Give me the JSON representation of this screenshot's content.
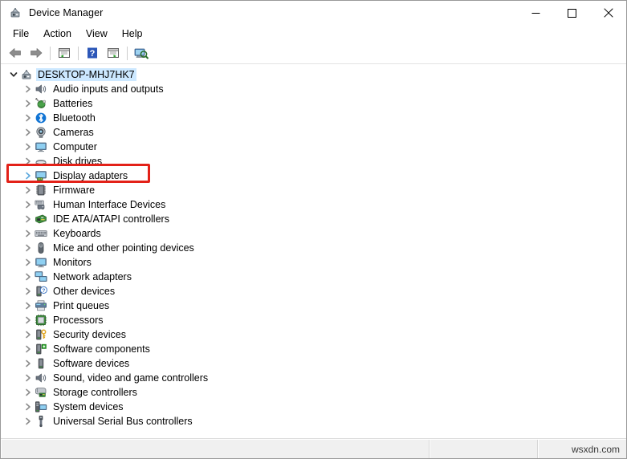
{
  "window": {
    "title": "Device Manager",
    "app_icon": "device-manager-icon",
    "controls": {
      "minimize": "minimize-button",
      "maximize": "maximize-button",
      "close": "close-button"
    }
  },
  "menubar": {
    "items": [
      {
        "label": "File"
      },
      {
        "label": "Action"
      },
      {
        "label": "View"
      },
      {
        "label": "Help"
      }
    ]
  },
  "toolbar": {
    "buttons": [
      {
        "name": "back-button",
        "icon": "back-arrow-icon"
      },
      {
        "name": "forward-button",
        "icon": "forward-arrow-icon"
      },
      {
        "name": "separator-1",
        "icon": "separator"
      },
      {
        "name": "show-hide-console-tree-button",
        "icon": "console-tree-icon"
      },
      {
        "name": "separator-2",
        "icon": "separator"
      },
      {
        "name": "help-button",
        "icon": "help-question-icon"
      },
      {
        "name": "properties-button",
        "icon": "properties-icon"
      },
      {
        "name": "separator-3",
        "icon": "separator"
      },
      {
        "name": "scan-for-hardware-changes-button",
        "icon": "scan-hardware-icon"
      }
    ]
  },
  "tree": {
    "root": {
      "label": "DESKTOP-MHJ7HK7",
      "icon": "computer-root-icon",
      "expanded": true,
      "selected": true
    },
    "items": [
      {
        "label": "Audio inputs and outputs",
        "icon": "speaker-icon"
      },
      {
        "label": "Batteries",
        "icon": "battery-icon"
      },
      {
        "label": "Bluetooth",
        "icon": "bluetooth-icon"
      },
      {
        "label": "Cameras",
        "icon": "camera-icon"
      },
      {
        "label": "Computer",
        "icon": "monitor-icon"
      },
      {
        "label": "Disk drives",
        "icon": "disk-drive-icon"
      },
      {
        "label": "Display adapters",
        "icon": "display-adapter-icon",
        "highlighted": true
      },
      {
        "label": "Firmware",
        "icon": "firmware-chip-icon"
      },
      {
        "label": "Human Interface Devices",
        "icon": "hid-icon"
      },
      {
        "label": "IDE ATA/ATAPI controllers",
        "icon": "ide-controller-icon"
      },
      {
        "label": "Keyboards",
        "icon": "keyboard-icon"
      },
      {
        "label": "Mice and other pointing devices",
        "icon": "mouse-icon"
      },
      {
        "label": "Monitors",
        "icon": "monitor-icon"
      },
      {
        "label": "Network adapters",
        "icon": "network-adapter-icon"
      },
      {
        "label": "Other devices",
        "icon": "unknown-device-icon"
      },
      {
        "label": "Print queues",
        "icon": "printer-icon"
      },
      {
        "label": "Processors",
        "icon": "processor-icon"
      },
      {
        "label": "Security devices",
        "icon": "security-device-icon"
      },
      {
        "label": "Software components",
        "icon": "software-component-icon"
      },
      {
        "label": "Software devices",
        "icon": "software-device-icon"
      },
      {
        "label": "Sound, video and game controllers",
        "icon": "speaker-icon"
      },
      {
        "label": "Storage controllers",
        "icon": "storage-controller-icon"
      },
      {
        "label": "System devices",
        "icon": "system-device-icon"
      },
      {
        "label": "Universal Serial Bus controllers",
        "icon": "usb-icon"
      }
    ]
  },
  "statusbar": {
    "main": "",
    "mid": "",
    "watermark": "wsxdn.com"
  },
  "colors": {
    "selection": "#cce8ff",
    "annotation": "#e32118",
    "chevron": "#767676",
    "statusbar_bg": "#f0f0f0"
  }
}
